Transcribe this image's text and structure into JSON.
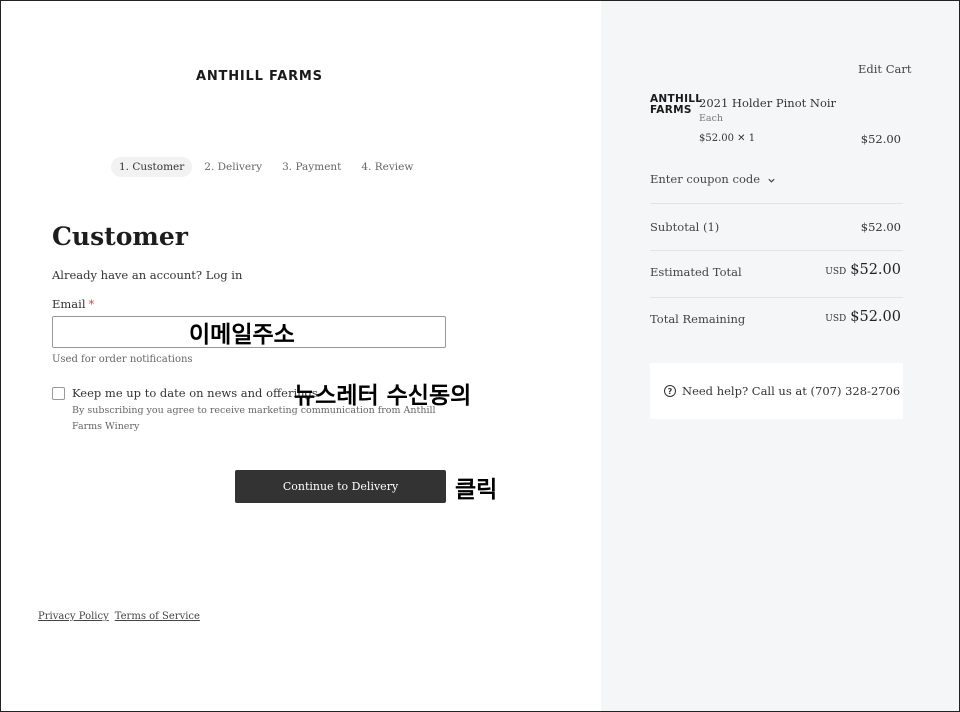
{
  "brand": {
    "logo_text": "ANTHILL FARMS"
  },
  "steps": [
    {
      "label": "1. Customer",
      "active": true
    },
    {
      "label": "2. Delivery",
      "active": false
    },
    {
      "label": "3. Payment",
      "active": false
    },
    {
      "label": "4. Review",
      "active": false
    }
  ],
  "customer": {
    "heading": "Customer",
    "account_prompt": "Already have an account?",
    "login_link": "Log in",
    "email_label": "Email",
    "email_required_mark": "*",
    "email_value": "",
    "email_helper": "Used for order notifications",
    "newsletter_label": "Keep me up to date on news and offerings",
    "newsletter_checked": false,
    "newsletter_sub": "By subscribing you agree to receive marketing communication from Anthill Farms Winery",
    "continue_label": "Continue to Delivery"
  },
  "annotations": {
    "email": "이메일주소",
    "newsletter": "뉴스레터 수신동의",
    "click": "클릭"
  },
  "footer": {
    "privacy": "Privacy Policy",
    "terms": "Terms of Service"
  },
  "cart": {
    "edit_label": "Edit Cart",
    "product_logo_line1": "ANTHILL",
    "product_logo_line2": "FARMS",
    "product_name": "2021 Holder Pinot Noir",
    "product_unit": "Each",
    "product_qty_line": "$52.00 ✕ 1",
    "product_price": "$52.00",
    "coupon_label": "Enter coupon code",
    "subtotal_label": "Subtotal (1)",
    "subtotal_value": "$52.00",
    "estimated_label": "Estimated Total",
    "estimated_currency": "USD",
    "estimated_value": "$52.00",
    "remaining_label": "Total Remaining",
    "remaining_currency": "USD",
    "remaining_value": "$52.00",
    "help_text": "Need help? Call us at (707) 328-2706"
  },
  "icons": {
    "help": "question-circle-icon",
    "coupon_toggle": "chevron-down-icon"
  }
}
